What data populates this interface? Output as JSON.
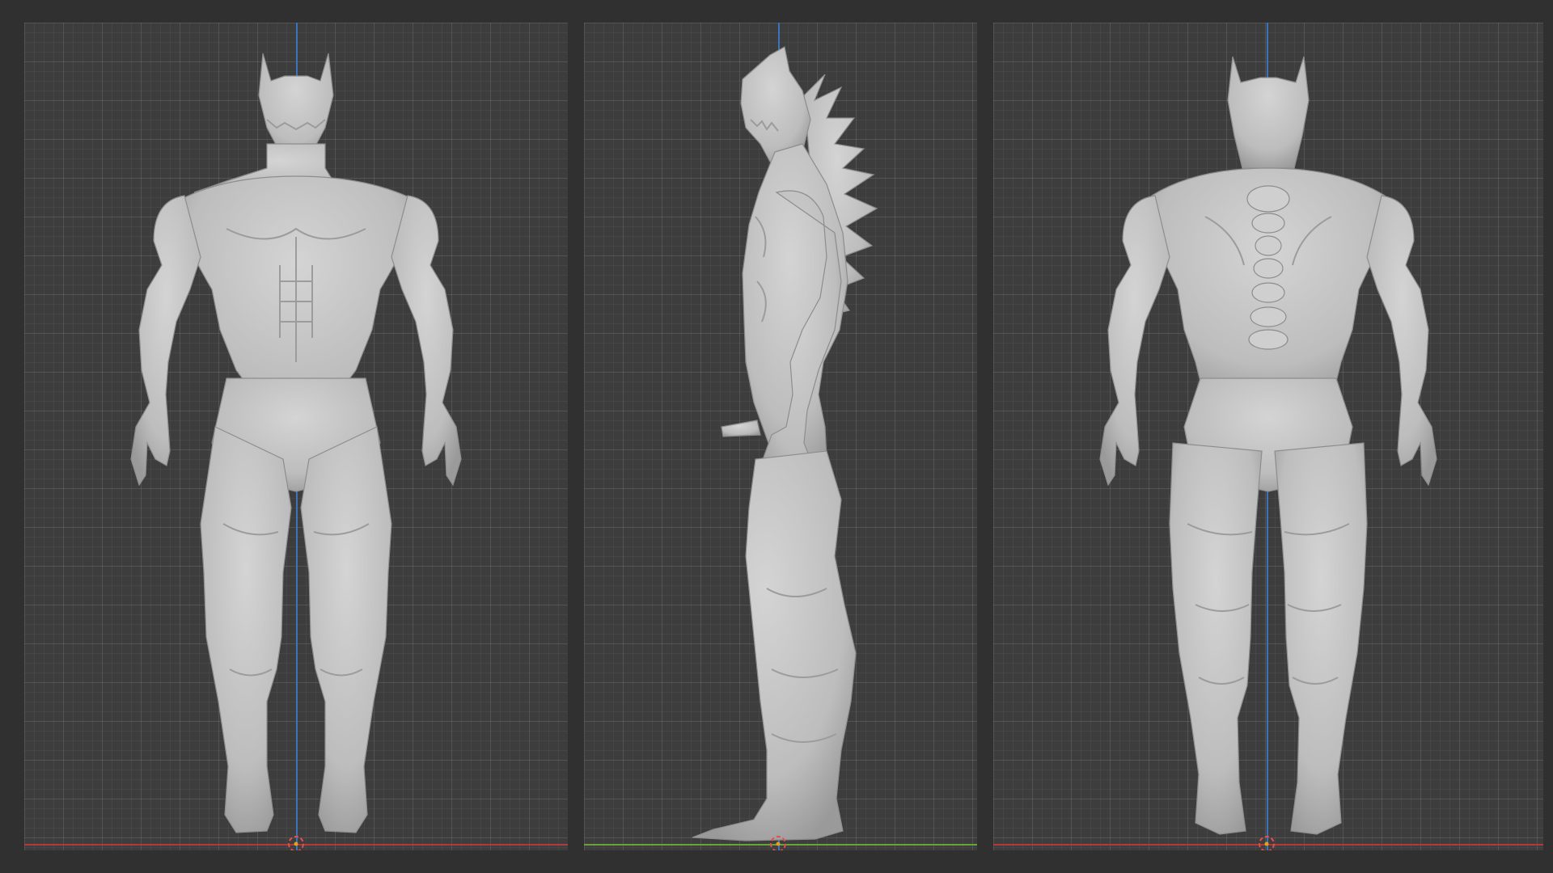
{
  "viewports": [
    {
      "id": "front",
      "view": "front"
    },
    {
      "id": "side",
      "view": "side"
    },
    {
      "id": "back",
      "view": "back"
    }
  ],
  "colors": {
    "background": "#303030",
    "viewport": "#3d3d3d",
    "model": "#c8c8c8",
    "axis_x": "#b23a3a",
    "axis_y": "#6aa23a",
    "axis_z": "#3c78c8",
    "origin": "#e0a020"
  },
  "icons": {
    "origin": "3d-cursor-icon"
  }
}
